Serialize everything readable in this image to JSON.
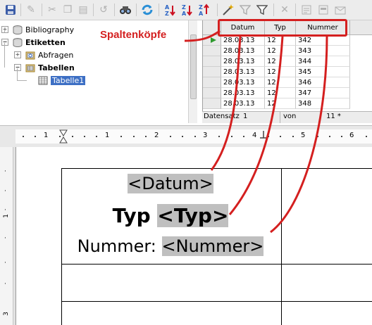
{
  "toolbar": {
    "icons": [
      "save-icon",
      "edit-icon",
      "cut-icon",
      "copy-icon",
      "paste-icon",
      "undo-icon",
      "find-icon",
      "refresh-icon",
      "sort-ascending-icon",
      "sort-descending-icon",
      "sort-icon",
      "autofilter-icon",
      "standard-filter-icon",
      "filter-icon",
      "remove-filter-icon",
      "data-to-text-icon",
      "data-to-fields-icon",
      "mail-merge-icon"
    ]
  },
  "tree": {
    "items": [
      {
        "label": "Bibliography",
        "bold": false
      },
      {
        "label": "Etiketten",
        "bold": true
      },
      {
        "label": "Abfragen",
        "bold": false
      },
      {
        "label": "Tabellen",
        "bold": true
      },
      {
        "label": "Tabelle1",
        "bold": false,
        "selected": true
      }
    ]
  },
  "grid": {
    "columns": [
      "Datum",
      "Typ",
      "Nummer"
    ],
    "rows": [
      [
        "28.03.13",
        "12",
        "342"
      ],
      [
        "28.03.13",
        "12",
        "343"
      ],
      [
        "28.03.13",
        "12",
        "344"
      ],
      [
        "28.03.13",
        "12",
        "345"
      ],
      [
        "28.03.13",
        "12",
        "346"
      ],
      [
        "28.03.13",
        "12",
        "347"
      ],
      [
        "28.03.13",
        "12",
        "348"
      ]
    ],
    "status": {
      "record_label": "Datensatz",
      "record_value": "1",
      "of_label": "von",
      "total": "11 *"
    }
  },
  "ruler": {
    "numbers": [
      "1",
      "1",
      "2",
      "3",
      "4",
      "5",
      "6"
    ]
  },
  "document": {
    "line1": "<Datum>",
    "line2_label": "Typ",
    "line2_field": "<Typ>",
    "line3_label": "Nummer:",
    "line3_field": "<Nummer>"
  },
  "annotation": {
    "label": "Spaltenköpfe",
    "color": "#d41f1f"
  }
}
